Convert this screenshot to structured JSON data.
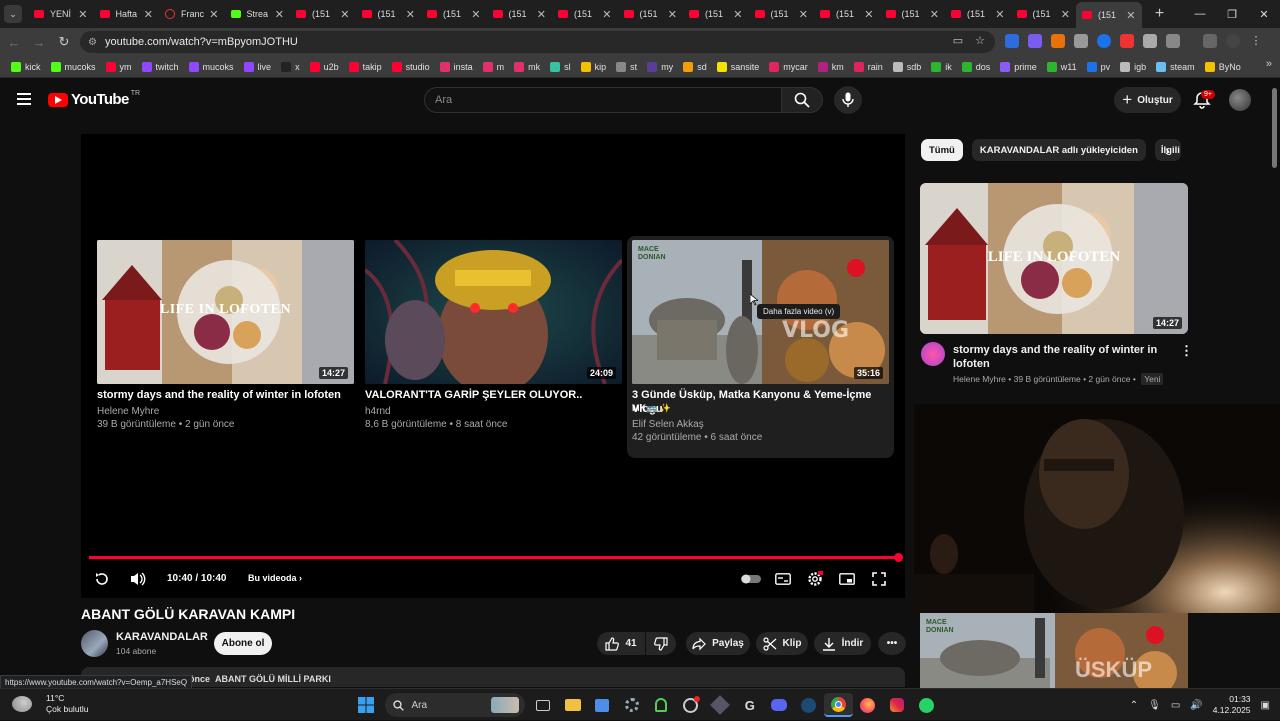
{
  "browser": {
    "tabs": [
      {
        "label": "YENİ",
        "favicon": "youtube"
      },
      {
        "label": "Hafta",
        "favicon": "youtube"
      },
      {
        "label": "Franc",
        "favicon": "firefox-relay"
      },
      {
        "label": "Strea",
        "favicon": "kick"
      },
      {
        "label": "(151",
        "favicon": "youtube"
      },
      {
        "label": "(151",
        "favicon": "youtube"
      },
      {
        "label": "(151",
        "favicon": "youtube"
      },
      {
        "label": "(151",
        "favicon": "youtube"
      },
      {
        "label": "(151",
        "favicon": "youtube"
      },
      {
        "label": "(151",
        "favicon": "youtube"
      },
      {
        "label": "(151",
        "favicon": "youtube"
      },
      {
        "label": "(151",
        "favicon": "youtube"
      },
      {
        "label": "(151",
        "favicon": "youtube"
      },
      {
        "label": "(151",
        "favicon": "youtube"
      },
      {
        "label": "(151",
        "favicon": "youtube"
      },
      {
        "label": "(151",
        "favicon": "youtube"
      },
      {
        "label": "(151",
        "favicon": "youtube",
        "active": true
      }
    ],
    "url": "youtube.com/watch?v=mBpyomJOTHU",
    "bookmarks": [
      {
        "label": "kick",
        "color": "#53fc18"
      },
      {
        "label": "mucoks",
        "color": "#53fc18"
      },
      {
        "label": "ym",
        "color": "#ff0033"
      },
      {
        "label": "twitch",
        "color": "#9146ff"
      },
      {
        "label": "mucoks",
        "color": "#9146ff"
      },
      {
        "label": "live",
        "color": "#9146ff"
      },
      {
        "label": "x",
        "color": "#222222"
      },
      {
        "label": "u2b",
        "color": "#ff0033"
      },
      {
        "label": "takip",
        "color": "#ff0033"
      },
      {
        "label": "studio",
        "color": "#ff0033"
      },
      {
        "label": "insta",
        "color": "#e1306c"
      },
      {
        "label": "m",
        "color": "#e1306c"
      },
      {
        "label": "mk",
        "color": "#e1306c"
      },
      {
        "label": "sl",
        "color": "#35c3a0"
      },
      {
        "label": "kip",
        "color": "#f2c200"
      },
      {
        "label": "st",
        "color": "#888888"
      },
      {
        "label": "my",
        "color": "#5a3d9a"
      },
      {
        "label": "sd",
        "color": "#f29f05"
      },
      {
        "label": "sansite",
        "color": "#f2e300"
      },
      {
        "label": "mycar",
        "color": "#e0245e"
      },
      {
        "label": "km",
        "color": "#b1217f"
      },
      {
        "label": "rain",
        "color": "#e0245e"
      },
      {
        "label": "sdb",
        "color": "#bbbbbb"
      },
      {
        "label": "ik",
        "color": "#2db52d"
      },
      {
        "label": "dos",
        "color": "#2db52d"
      },
      {
        "label": "prime",
        "color": "#8b5cf6"
      },
      {
        "label": "w11",
        "color": "#2db52d"
      },
      {
        "label": "pv",
        "color": "#1a73e8"
      },
      {
        "label": "igb",
        "color": "#bbbbbb"
      },
      {
        "label": "steam",
        "color": "#66c0f4"
      },
      {
        "label": "ByNo",
        "color": "#f2c200"
      }
    ]
  },
  "youtube": {
    "logo_word": "YouTube",
    "country_code": "TR",
    "search_placeholder": "Ara",
    "create_label": "Oluştur",
    "notif_badge": "9+"
  },
  "player": {
    "progress_fraction": 1.0,
    "time": "10:40 / 10:40",
    "chapter_label": "Bu videoda",
    "tooltip": "Daha fazla video (v)",
    "endcards": [
      {
        "title": "stormy days and the reality of winter in lofoten",
        "channel": "Helene Myhre",
        "meta": "39 B görüntüleme • 2 gün önce",
        "duration": "14:27",
        "thumb_text": "LIFE IN LOFOTEN"
      },
      {
        "title": "VALORANT'TA GARİP ŞEYLER OLUYOR..",
        "channel": "h4rnd",
        "meta": "8,6 B görüntüleme • 8 saat önce",
        "duration": "24:09"
      },
      {
        "title": "3 Günde Üsküp, Matka Kanyonu & Yeme-İçme Vlogu",
        "title2": "MK🚌 ✨",
        "channel": "Elif Selen Akkaş",
        "meta": "42 görüntüleme • 6 saat önce",
        "duration": "35:16",
        "thumb_text": "VLOG",
        "thumb_corner": "MACE\nDONIAN"
      }
    ]
  },
  "video": {
    "title": "ABANT GÖLÜ KARAVAN KAMPI",
    "channel": "KARAVANDALAR",
    "subscribers": "104 abone",
    "subscribe_label": "Abone ol",
    "likes": "41",
    "share_label": "Paylaş",
    "clip_label": "Klip",
    "download_label": "İndir",
    "desc_time": "önce",
    "desc_location": "ABANT GÖLÜ MİLLİ PARKI",
    "status_url": "https://www.youtube.com/watch?v=Oemp_a7HSeQ"
  },
  "sidebar": {
    "chips": [
      "Tümü",
      "KARAVANDALAR adlı yükleyiciden",
      "İlgili"
    ],
    "video1": {
      "title": "stormy days and the reality of winter in lofoten",
      "channel": "Helene Myhre",
      "meta": "39 B görüntüleme • 2 gün önce",
      "new_badge": "Yeni",
      "duration": "14:27",
      "thumb_text": "LIFE IN LOFOTEN"
    },
    "video2": {
      "thumb_text": "ÜSKÜP",
      "thumb_corner": "MACE\nDONIAN"
    }
  },
  "taskbar": {
    "temperature": "11°C",
    "weather": "Çok bulutlu",
    "search_placeholder": "Ara",
    "time": "01:33",
    "date": "4.12.2025"
  }
}
